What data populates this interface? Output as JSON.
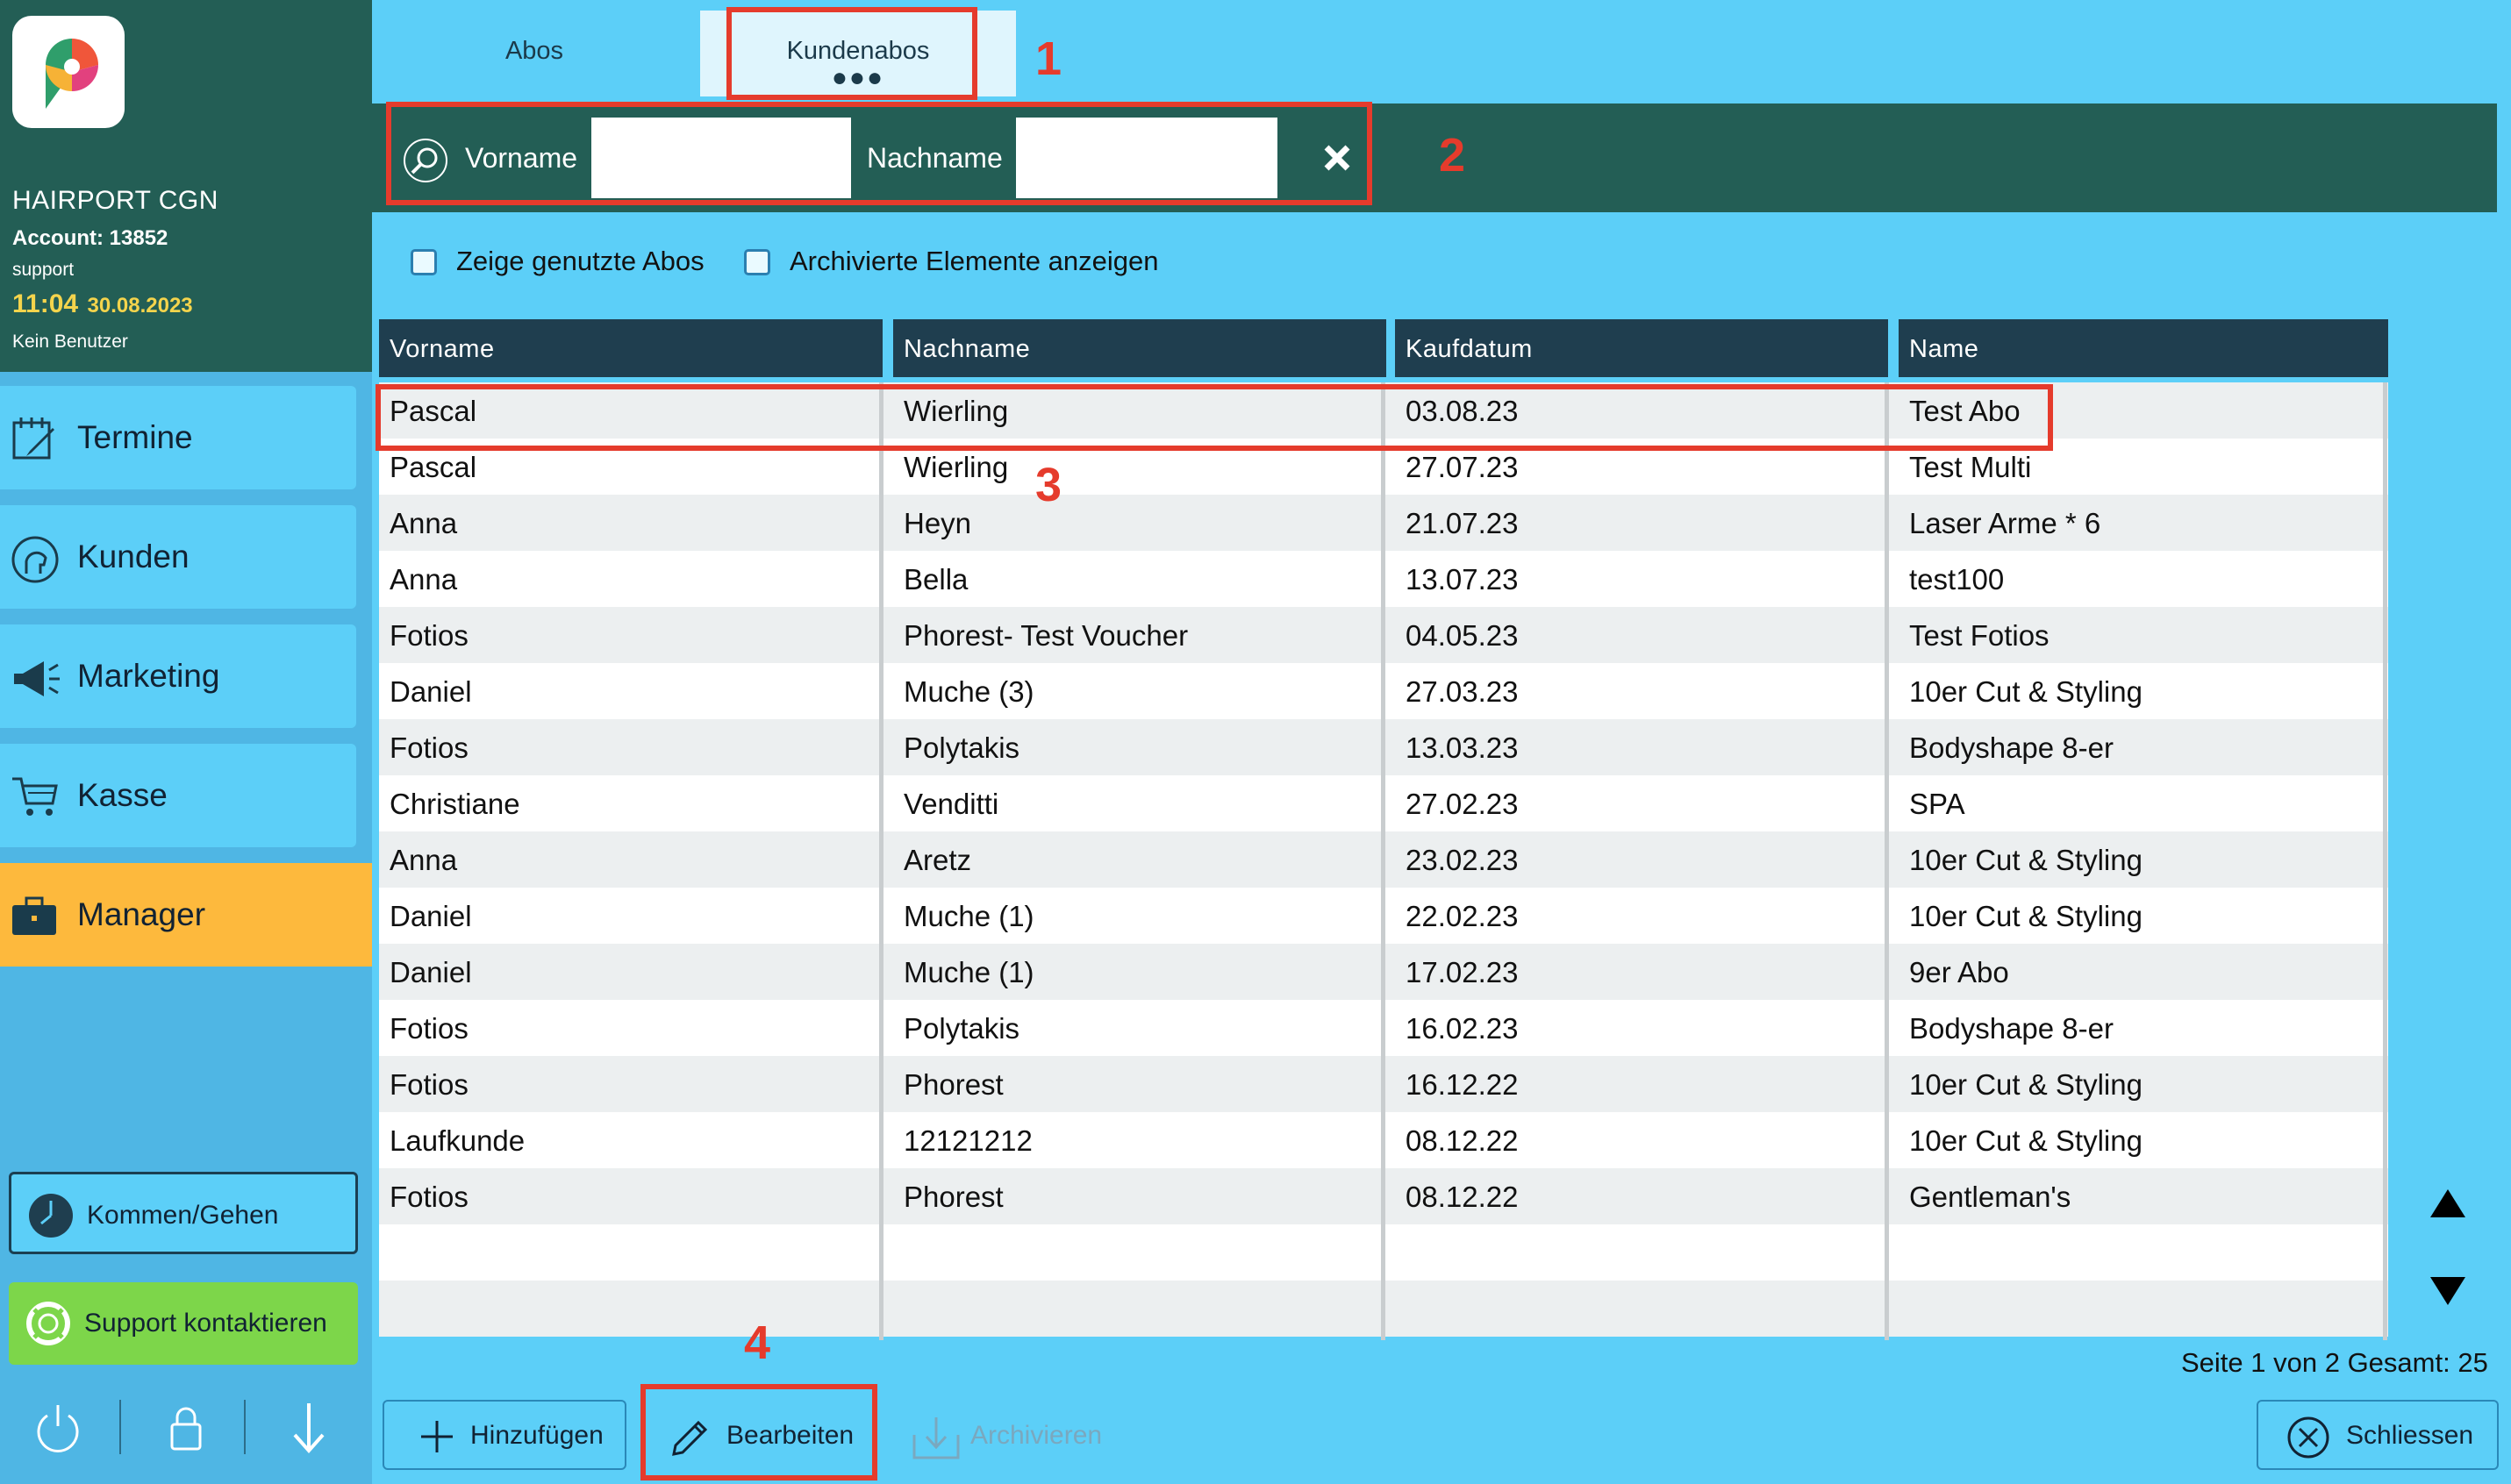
{
  "sidebar": {
    "salon_name": "HAIRPORT CGN",
    "account": "Account: 13852",
    "role": "support",
    "time": "11:04",
    "date": "30.08.2023",
    "no_user": "Kein Benutzer",
    "nav": [
      {
        "label": "Termine",
        "icon": "calendar-edit-icon"
      },
      {
        "label": "Kunden",
        "icon": "head-icon"
      },
      {
        "label": "Marketing",
        "icon": "megaphone-icon"
      },
      {
        "label": "Kasse",
        "icon": "cart-icon"
      },
      {
        "label": "Manager",
        "icon": "briefcase-icon"
      }
    ],
    "kommen_gehen": "Kommen/Gehen",
    "support": "Support kontaktieren"
  },
  "tabs": {
    "abos": "Abos",
    "kundenabos": "Kundenabos",
    "dots": "●●●"
  },
  "search": {
    "vorname_label": "Vorname",
    "nachname_label": "Nachname",
    "vorname_value": "",
    "nachname_value": ""
  },
  "filters": {
    "used_label": "Zeige genutzte Abos",
    "used_checked": false,
    "archived_label": "Archivierte Elemente anzeigen",
    "archived_checked": false
  },
  "table": {
    "columns": [
      "Vorname",
      "Nachname",
      "Kaufdatum",
      "Name"
    ],
    "rows": [
      [
        "Pascal",
        "Wierling",
        "03.08.23",
        "Test Abo"
      ],
      [
        "Pascal",
        "Wierling",
        "27.07.23",
        "Test Multi"
      ],
      [
        "Anna",
        "Heyn",
        "21.07.23",
        "Laser Arme * 6"
      ],
      [
        "Anna",
        "Bella",
        "13.07.23",
        "test100"
      ],
      [
        "Fotios",
        "Phorest- Test Voucher",
        "04.05.23",
        "Test Fotios"
      ],
      [
        "Daniel",
        "Muche (3)",
        "27.03.23",
        "10er Cut & Styling"
      ],
      [
        "Fotios",
        "Polytakis",
        "13.03.23",
        "Bodyshape 8-er"
      ],
      [
        "Christiane",
        "Venditti",
        "27.02.23",
        "SPA"
      ],
      [
        "Anna",
        "Aretz",
        "23.02.23",
        "10er Cut & Styling"
      ],
      [
        "Daniel",
        "Muche (1)",
        "22.02.23",
        "10er Cut & Styling"
      ],
      [
        "Daniel",
        "Muche (1)",
        "17.02.23",
        "9er Abo"
      ],
      [
        "Fotios",
        "Polytakis",
        "16.02.23",
        "Bodyshape 8-er"
      ],
      [
        "Fotios",
        "Phorest",
        "16.12.22",
        "10er Cut & Styling"
      ],
      [
        "Laufkunde",
        "12121212",
        "08.12.22",
        "10er Cut & Styling"
      ],
      [
        "Fotios",
        "Phorest",
        "08.12.22",
        "Gentleman's"
      ],
      [
        "",
        "",
        "",
        ""
      ],
      [
        "",
        "",
        "",
        ""
      ]
    ]
  },
  "pagination": "Seite 1 von 2 Gesamt: 25",
  "toolbar": {
    "add": "Hinzufügen",
    "edit": "Bearbeiten",
    "archive": "Archivieren",
    "close": "Schliessen"
  },
  "annotations": [
    "1",
    "2",
    "3",
    "4"
  ],
  "colors": {
    "accent_red": "#e53b2c",
    "header_dark": "#235e55",
    "sky": "#5ccff8",
    "manager_orange": "#fdb93d",
    "support_green": "#7dd64a"
  }
}
